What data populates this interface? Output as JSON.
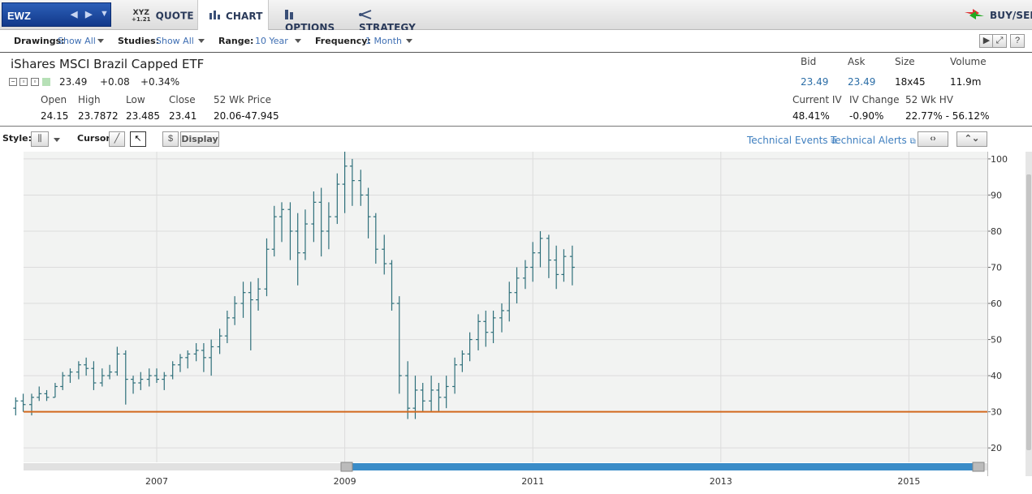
{
  "topbar": {
    "symbol": "EWZ",
    "tabs": [
      {
        "label": "QUOTE",
        "icon": "xyz-quote-icon",
        "icon_text": "XYZ",
        "icon_sub": "+1.21"
      },
      {
        "label": "CHART",
        "icon": "bar-chart-icon"
      },
      {
        "label": "OPTIONS",
        "icon": "options-icon"
      },
      {
        "label": "STRATEGY",
        "icon": "strategy-icon"
      }
    ],
    "buy_sell": "BUY/SELL"
  },
  "settings": {
    "drawings_label": "Drawings:",
    "drawings_value": "Show All",
    "studies_label": "Studies:",
    "studies_value": "Show All",
    "range_label": "Range:",
    "range_value": "10 Year",
    "frequency_label": "Frequency:",
    "frequency_value": "1 Month"
  },
  "quote": {
    "name": "iShares MSCI Brazil Capped ETF",
    "last": "23.49",
    "change": "+0.08",
    "change_pct": "+0.34%",
    "open_label": "Open",
    "open": "24.15",
    "high_label": "High",
    "high": "23.7872",
    "low_label": "Low",
    "low": "23.485",
    "close_label": "Close",
    "close": "23.41",
    "wk52_label": "52 Wk Price",
    "wk52": "20.06-47.945",
    "bid_label": "Bid",
    "bid": "23.49",
    "ask_label": "Ask",
    "ask": "23.49",
    "size_label": "Size",
    "size": "18x45",
    "volume_label": "Volume",
    "volume": "11.9m",
    "iv_label": "Current IV",
    "iv": "48.41%",
    "ivchg_label": "IV Change",
    "ivchg": "-0.90%",
    "hv_label": "52 Wk HV",
    "hv": "22.77% - 56.12%"
  },
  "stylebar": {
    "style_label": "Style:",
    "cursor_label": "Cursor:",
    "dollar": "$",
    "display": "Display",
    "technical_events": "Technical Events",
    "technical_alerts": "Technical Alerts"
  },
  "chart_data": {
    "type": "ohlc-bar",
    "frequency": "monthly",
    "x_tick_labels": [
      "2007",
      "2009",
      "2011",
      "2013",
      "2015"
    ],
    "y_ticks": [
      20,
      30,
      40,
      50,
      60,
      70,
      80,
      90,
      100
    ],
    "ylim": [
      16,
      102
    ],
    "horizontal_line": {
      "value": 30,
      "color": "#d2691e"
    },
    "grid": true,
    "bar_color": "#2e6f7a",
    "bars": [
      [
        2005.5,
        31,
        34,
        29,
        33
      ],
      [
        2005.58,
        33,
        35,
        30,
        32
      ],
      [
        2005.67,
        32,
        35,
        29,
        34
      ],
      [
        2005.75,
        34,
        37,
        33,
        35
      ],
      [
        2005.83,
        35,
        36,
        33,
        34
      ],
      [
        2005.92,
        34,
        38,
        34,
        37
      ],
      [
        2006.0,
        37,
        41,
        36,
        40
      ],
      [
        2006.08,
        40,
        42,
        38,
        41
      ],
      [
        2006.17,
        41,
        44,
        39,
        43
      ],
      [
        2006.25,
        43,
        45,
        40,
        42
      ],
      [
        2006.33,
        42,
        44,
        36,
        38
      ],
      [
        2006.42,
        38,
        42,
        37,
        40
      ],
      [
        2006.5,
        40,
        43,
        39,
        41
      ],
      [
        2006.58,
        41,
        48,
        40,
        46
      ],
      [
        2006.67,
        46,
        47,
        32,
        39
      ],
      [
        2006.75,
        39,
        40,
        35,
        38
      ],
      [
        2006.83,
        38,
        41,
        36,
        39
      ],
      [
        2006.92,
        39,
        42,
        37,
        40
      ],
      [
        2007.0,
        40,
        42,
        38,
        39
      ],
      [
        2007.08,
        39,
        41,
        36,
        40
      ],
      [
        2007.17,
        40,
        44,
        39,
        43
      ],
      [
        2007.25,
        43,
        46,
        41,
        45
      ],
      [
        2007.33,
        45,
        47,
        42,
        46
      ],
      [
        2007.42,
        46,
        49,
        44,
        47
      ],
      [
        2007.5,
        47,
        49,
        41,
        45
      ],
      [
        2007.58,
        45,
        50,
        40,
        48
      ],
      [
        2007.67,
        48,
        53,
        46,
        51
      ],
      [
        2007.75,
        51,
        58,
        49,
        56
      ],
      [
        2007.83,
        56,
        62,
        54,
        60
      ],
      [
        2007.92,
        60,
        66,
        56,
        63
      ],
      [
        2008.0,
        63,
        66,
        47,
        61
      ],
      [
        2008.08,
        61,
        67,
        58,
        64
      ],
      [
        2008.17,
        64,
        78,
        62,
        75
      ],
      [
        2008.25,
        75,
        87,
        73,
        84
      ],
      [
        2008.33,
        84,
        88,
        77,
        86
      ],
      [
        2008.42,
        86,
        88,
        72,
        80
      ],
      [
        2008.5,
        80,
        85,
        65,
        74
      ],
      [
        2008.58,
        74,
        86,
        72,
        82
      ],
      [
        2008.67,
        82,
        91,
        77,
        88
      ],
      [
        2008.75,
        88,
        92,
        73,
        80
      ],
      [
        2008.83,
        80,
        88,
        75,
        84
      ],
      [
        2008.92,
        84,
        96,
        82,
        93
      ],
      [
        2009.0,
        93,
        102,
        85,
        98
      ],
      [
        2009.08,
        98,
        100,
        87,
        94
      ],
      [
        2009.17,
        94,
        97,
        87,
        90
      ],
      [
        2009.25,
        90,
        92,
        78,
        84
      ],
      [
        2009.33,
        84,
        85,
        71,
        75
      ],
      [
        2009.42,
        75,
        79,
        68,
        71
      ],
      [
        2009.5,
        71,
        72,
        58,
        60
      ],
      [
        2009.58,
        60,
        62,
        35,
        40
      ],
      [
        2009.67,
        40,
        44,
        28,
        31
      ],
      [
        2009.75,
        31,
        40,
        28,
        36
      ],
      [
        2009.83,
        36,
        38,
        30,
        33
      ],
      [
        2009.92,
        33,
        40,
        30,
        36
      ],
      [
        2010.0,
        36,
        38,
        30,
        34
      ],
      [
        2010.08,
        34,
        40,
        31,
        37
      ],
      [
        2010.17,
        37,
        45,
        35,
        43
      ],
      [
        2010.25,
        43,
        47,
        41,
        46
      ],
      [
        2010.33,
        46,
        52,
        44,
        50
      ],
      [
        2010.42,
        50,
        57,
        47,
        55
      ],
      [
        2010.5,
        55,
        58,
        48,
        52
      ],
      [
        2010.58,
        52,
        58,
        49,
        56
      ],
      [
        2010.67,
        56,
        60,
        52,
        58
      ],
      [
        2010.75,
        58,
        66,
        55,
        63
      ],
      [
        2010.83,
        63,
        70,
        60,
        67
      ],
      [
        2010.92,
        67,
        72,
        64,
        70
      ],
      [
        2011.0,
        70,
        77,
        66,
        74
      ],
      [
        2011.08,
        74,
        80,
        70,
        78
      ],
      [
        2011.17,
        78,
        79,
        67,
        72
      ],
      [
        2011.25,
        72,
        76,
        64,
        68
      ],
      [
        2011.33,
        68,
        75,
        66,
        73
      ],
      [
        2011.42,
        73,
        76,
        65,
        70
      ]
    ]
  }
}
